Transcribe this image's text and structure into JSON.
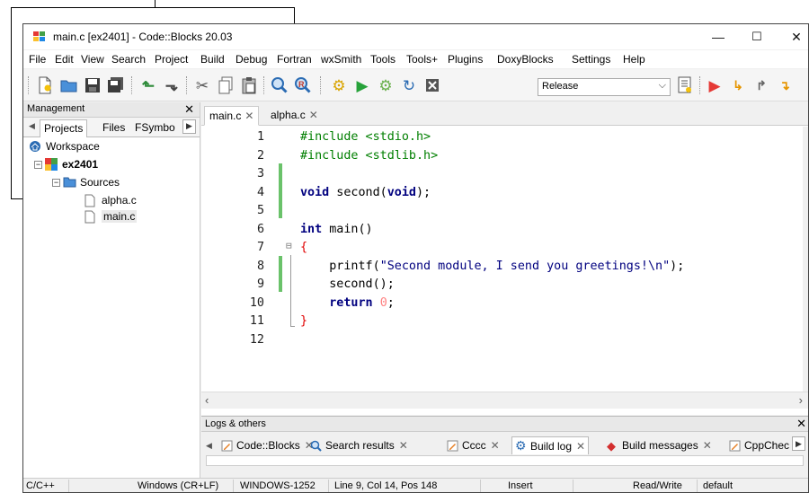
{
  "window": {
    "title": "main.c [ex2401] - Code::Blocks 20.03",
    "minimize": "—",
    "maximize": "☐",
    "close": "✕"
  },
  "menu": [
    "File",
    "Edit",
    "View",
    "Search",
    "Project",
    "Build",
    "Debug",
    "Fortran",
    "wxSmith",
    "Tools",
    "Tools+",
    "Plugins",
    "DoxyBlocks",
    "Settings",
    "Help"
  ],
  "toolbar": {
    "build_target": "Release",
    "icons": [
      "new-file-icon",
      "open-icon",
      "save-icon",
      "save-all-icon",
      "undo-icon",
      "redo-icon",
      "cut-icon",
      "copy-icon",
      "paste-icon",
      "find-icon",
      "replace-icon",
      "build-icon",
      "run-icon",
      "build-run-icon",
      "rebuild-icon",
      "abort-icon",
      "build-target-icon",
      "debug-icon",
      "run-to-cursor-icon",
      "next-line-icon",
      "step-into-icon"
    ]
  },
  "management": {
    "title": "Management",
    "tabs": [
      "Projects",
      "Files",
      "FSymbo"
    ],
    "tree": {
      "workspace": "Workspace",
      "project": "ex2401",
      "folder": "Sources",
      "files": [
        "alpha.c",
        "main.c"
      ]
    }
  },
  "editor": {
    "tabs": [
      {
        "label": "main.c"
      },
      {
        "label": "alpha.c"
      }
    ],
    "line_numbers": [
      "1",
      "2",
      "3",
      "4",
      "5",
      "6",
      "7",
      "8",
      "9",
      "10",
      "11",
      "12"
    ],
    "code": [
      "#include <stdio.h>",
      "#include <stdlib.h>",
      "",
      "void second(void);",
      "",
      "int main()",
      "{",
      "    printf(\"Second module, I send you greetings!\\n\");",
      "    second();",
      "    return 0;",
      "}",
      ""
    ]
  },
  "logs": {
    "title": "Logs & others",
    "tabs": [
      "Code::Blocks",
      "Search results",
      "Cccc",
      "Build log",
      "Build messages",
      "CppChec"
    ]
  },
  "status": {
    "language": "C/C++",
    "line_endings": "Windows (CR+LF)",
    "encoding": "WINDOWS-1252",
    "position": "Line 9, Col 14, Pos 148",
    "mode": "Insert",
    "access": "Read/Write",
    "profile": "default"
  }
}
